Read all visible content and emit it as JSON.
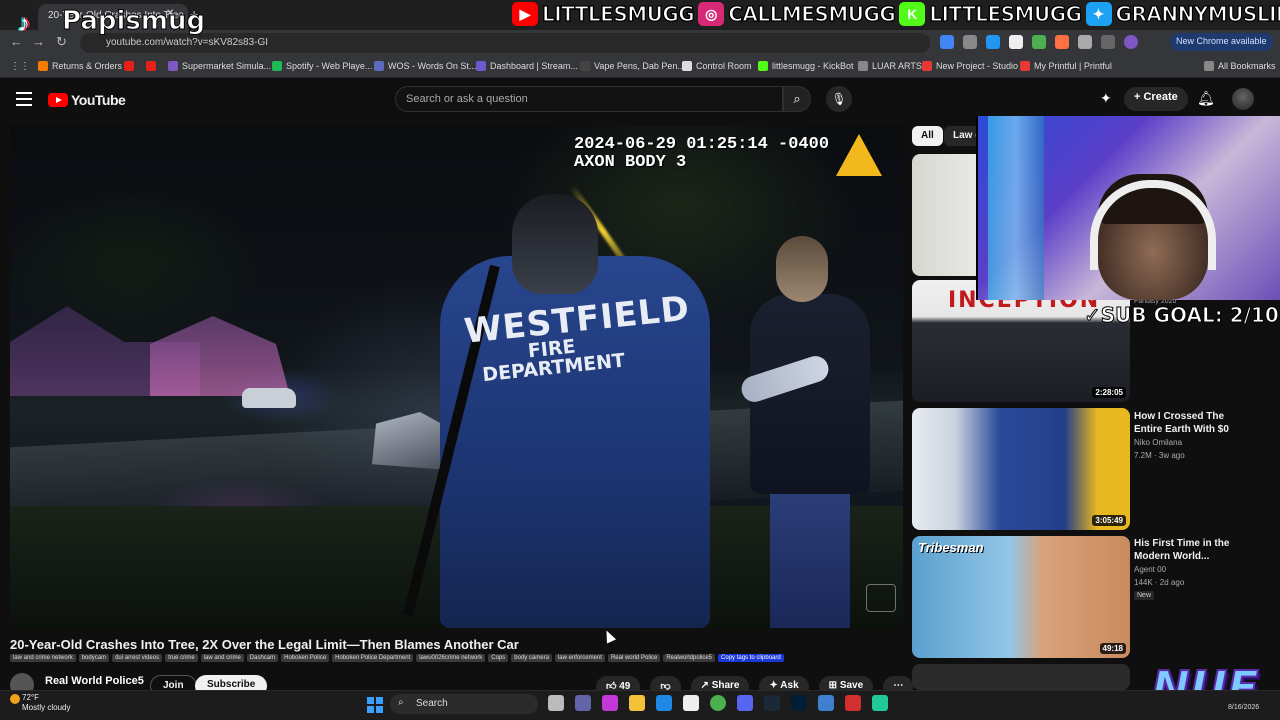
{
  "browser": {
    "tab_title": "20-Year-Old Crashes Into Tree",
    "url": "youtube.com/watch?v=sKV82s83-GI",
    "new_chrome_label": "New Chrome available",
    "bookmarks": [
      {
        "label": "Returns & Orders",
        "color": "#f57c00"
      },
      {
        "label": "",
        "color": "#e62117"
      },
      {
        "label": "",
        "color": "#e62117"
      },
      {
        "label": "Supermarket Simula...",
        "color": "#7e57c2"
      },
      {
        "label": "Spotify - Web Playe...",
        "color": "#1db954"
      },
      {
        "label": "WOS - Words On St...",
        "color": "#5c6bc0"
      },
      {
        "label": "Dashboard | Stream...",
        "color": "#6a5acd"
      },
      {
        "label": "Vape Pens, Dab Pen...",
        "color": "#444444"
      },
      {
        "label": "Control Room",
        "color": "#dddddd"
      },
      {
        "label": "littlesmugg - KickBot",
        "color": "#53fc18"
      },
      {
        "label": "LUAR ARTS",
        "color": "#888888"
      },
      {
        "label": "New Project - Studio",
        "color": "#e53935"
      },
      {
        "label": "My Printful | Printful",
        "color": "#e53935"
      }
    ],
    "all_bookmarks_label": "All Bookmarks"
  },
  "overlay": {
    "tiktok_name": "Papismug",
    "socials": [
      {
        "icon": "youtube-icon",
        "name": "LITTLESMUGG",
        "color": "#ff0000"
      },
      {
        "icon": "instagram-icon",
        "name": "CALLMESMUGG",
        "color": "#d62976"
      },
      {
        "icon": "kick-icon",
        "name": "LITTLESMUGG",
        "color": "#53fc18"
      },
      {
        "icon": "twitter-icon",
        "name": "GRANNYMUSLIM",
        "color": "#1da1f2"
      }
    ],
    "sub_goal": "SUB GOAL: 2/10",
    "logo_text": "NUE"
  },
  "youtube": {
    "logo_text": "YouTube",
    "search_placeholder": "Search or ask a question",
    "create_label": "Create",
    "video": {
      "timestamp_line1": "2024-06-29 01:25:14 -0400",
      "timestamp_line2": "AXON BODY 3",
      "shirt_line1": "WESTFIELD",
      "shirt_line2": "FIRE DEPARTMENT",
      "title": "20-Year-Old Crashes Into Tree, 2X Over the Legal Limit—Then Blames Another Car",
      "tags": [
        "law and crime network",
        "bodycam",
        "dui arrest videos",
        "true crime",
        "law and crime",
        "Dashcam",
        "Hoboken Police",
        "Hoboken Police Department",
        "lawu0026crime network",
        "Cops",
        "body camera",
        "law enforcement",
        "Real world Police",
        "Realworldpolice5"
      ],
      "copy_tags_label": "Copy tags to clipboard",
      "channel_name": "Real World Police5",
      "join_label": "Join",
      "subscribe_label": "Subscribe",
      "like_count": "49",
      "share_label": "Share",
      "ask_label": "Ask",
      "save_label": "Save"
    },
    "chips": [
      "All",
      "Law e"
    ],
    "recommendations": [
      {
        "title": "",
        "channel": "",
        "meta": "",
        "duration": ""
      },
      {
        "title": "",
        "channel": "",
        "meta": "",
        "duration": "2:28:05",
        "thumb_text": "INCEPTION",
        "extra": "Fantasy 2020"
      },
      {
        "title": "How I Crossed The Entire Earth With $0",
        "channel": "Niko Omilana",
        "meta": "7.2M · 3w ago",
        "duration": "3:05:49"
      },
      {
        "title": "His First Time in the Modern World...",
        "channel": "Agent 00",
        "meta": "144K · 2d ago",
        "duration": "49:18",
        "badge": "New",
        "thumb_text": "Tribesman"
      }
    ]
  },
  "taskbar": {
    "temperature": "72°F",
    "weather": "Mostly cloudy",
    "search_label": "Search",
    "date": "8/16/2026"
  }
}
